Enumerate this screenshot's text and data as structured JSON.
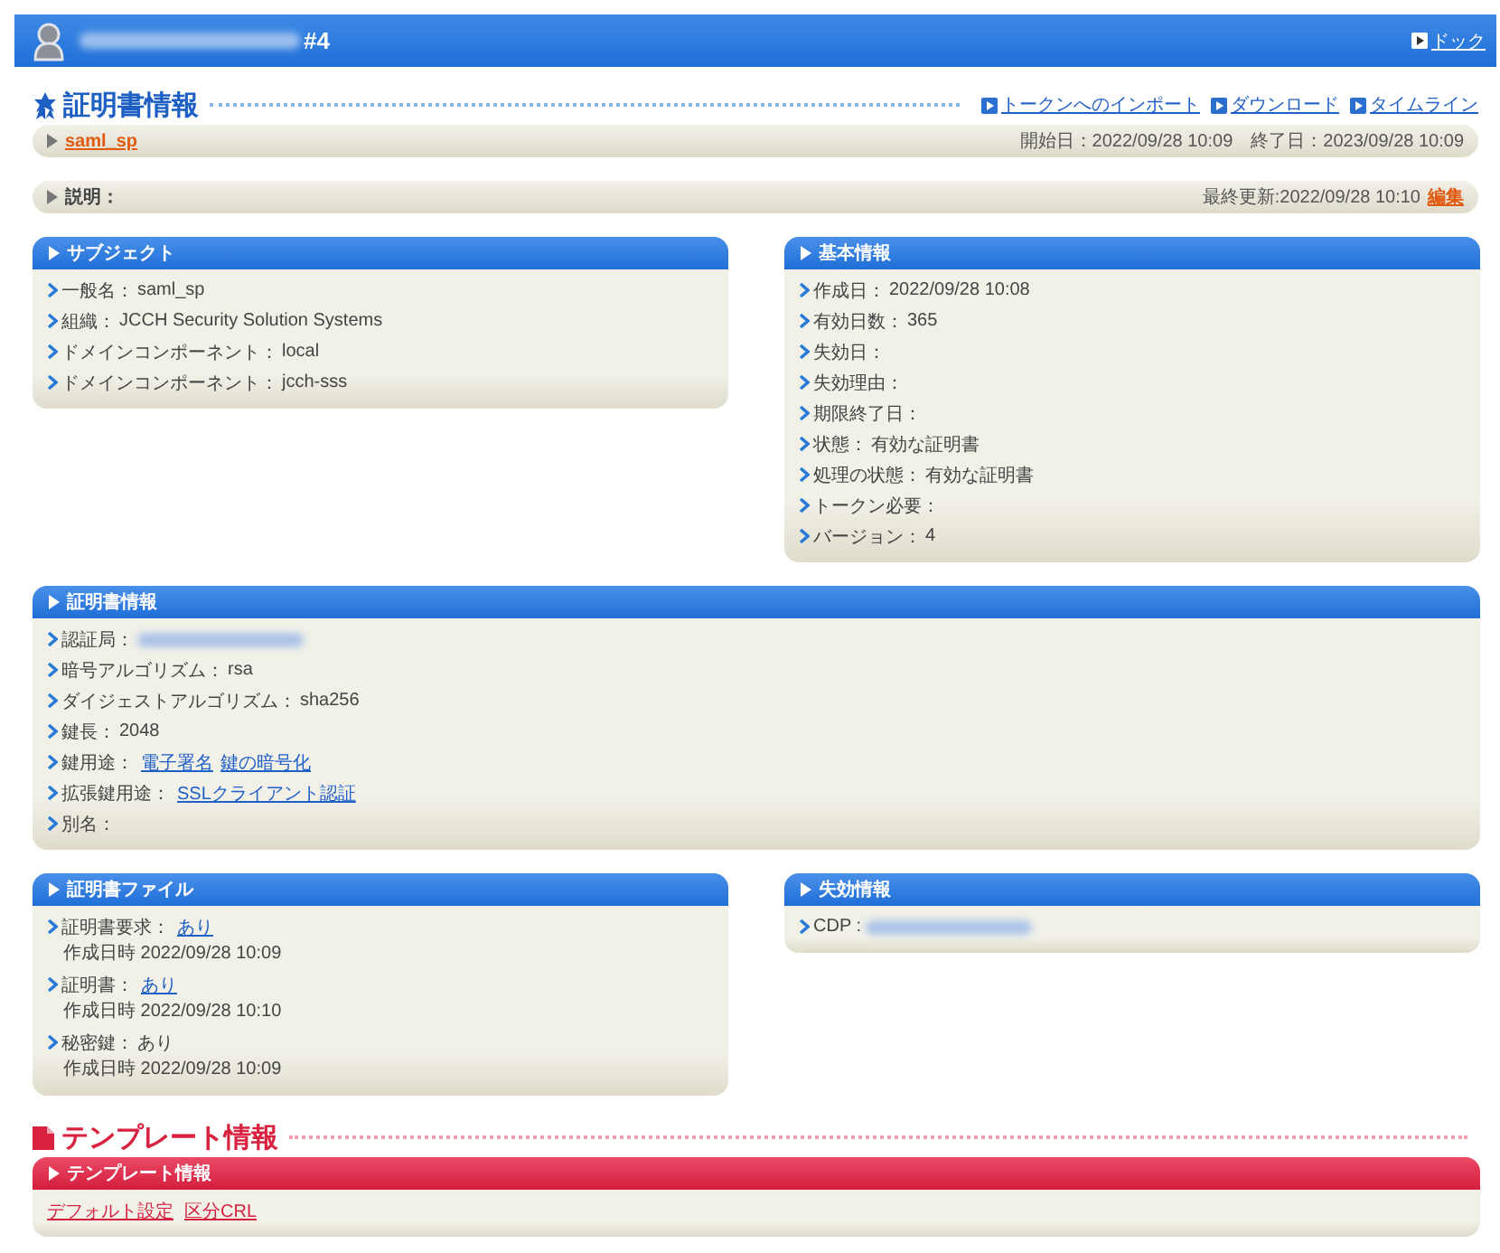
{
  "header": {
    "title": "#4",
    "link": "ドック"
  },
  "sections": [
    {
      "kind": "certificate",
      "title": "証明書情報",
      "links": [
        "トークンへのインポート",
        "ダウンロード",
        "タイムライン"
      ],
      "bars": [
        {
          "kind": "name",
          "link": "saml_sp",
          "info": "開始日：2022/09/28 10:09　終了日：2023/09/28 10:09"
        },
        {
          "kind": "description",
          "label": "説明：",
          "info": "最終更新:2022/09/28 10:10",
          "link": "編集"
        }
      ],
      "panels": [
        {
          "kind": "half",
          "title": "サブジェクト",
          "items": [
            {
              "kind": "text",
              "label": "一般名：",
              "value": "saml_sp"
            },
            {
              "kind": "text",
              "label": "組織：",
              "value": "JCCH Security Solution Systems"
            },
            {
              "kind": "text",
              "label": "ドメインコンポーネント：",
              "value": "local"
            },
            {
              "kind": "text",
              "label": "ドメインコンポーネント：",
              "value": "jcch-sss"
            }
          ]
        },
        {
          "kind": "half",
          "title": "基本情報",
          "items": [
            {
              "kind": "text",
              "label": "作成日：",
              "value": "2022/09/28 10:08"
            },
            {
              "kind": "text",
              "label": "有効日数：",
              "value": "365"
            },
            {
              "kind": "text",
              "label": "失効日："
            },
            {
              "kind": "text",
              "label": "失効理由："
            },
            {
              "kind": "text",
              "label": "期限終了日："
            },
            {
              "kind": "text",
              "label": "状態：",
              "value": "有効な証明書"
            },
            {
              "kind": "text",
              "label": "処理の状態：",
              "value": "有効な証明書"
            },
            {
              "kind": "text",
              "label": "トークン必要："
            },
            {
              "kind": "text",
              "label": "バージョン：",
              "value": "4"
            }
          ]
        },
        {
          "kind": "full",
          "title": "証明書情報",
          "items": [
            {
              "kind": "redacted",
              "label": "認証局："
            },
            {
              "kind": "text",
              "label": "暗号アルゴリズム：",
              "value": "rsa"
            },
            {
              "kind": "text",
              "label": "ダイジェストアルゴリズム：",
              "value": "sha256"
            },
            {
              "kind": "text",
              "label": "鍵長：",
              "value": "2048"
            },
            {
              "kind": "links",
              "label": "鍵用途：",
              "links": [
                "電子署名",
                "鍵の暗号化"
              ]
            },
            {
              "kind": "links",
              "label": "拡張鍵用途：",
              "links": [
                "SSLクライアント認証"
              ]
            },
            {
              "kind": "text",
              "label": "別名："
            }
          ]
        },
        {
          "kind": "half",
          "title": "証明書ファイル",
          "items": [
            {
              "kind": "links",
              "label": "証明書要求：",
              "links": [
                "あり"
              ],
              "note": "作成日時 2022/09/28 10:09"
            },
            {
              "kind": "links",
              "label": "証明書：",
              "links": [
                "あり"
              ],
              "note": "作成日時 2022/09/28 10:10"
            },
            {
              "kind": "text",
              "label": "秘密鍵：",
              "value": "あり",
              "note": "作成日時 2022/09/28 10:09"
            }
          ]
        },
        {
          "kind": "half",
          "title": "失効情報",
          "items": [
            {
              "kind": "redacted",
              "label": "CDP :"
            }
          ]
        }
      ]
    },
    {
      "kind": "template",
      "title": "テンプレート情報",
      "panels": [
        {
          "kind": "full",
          "title": "テンプレート情報",
          "items": [
            {
              "kind": "linkrow",
              "links": [
                "デフォルト設定",
                "区分CRL"
              ]
            }
          ]
        }
      ]
    }
  ]
}
